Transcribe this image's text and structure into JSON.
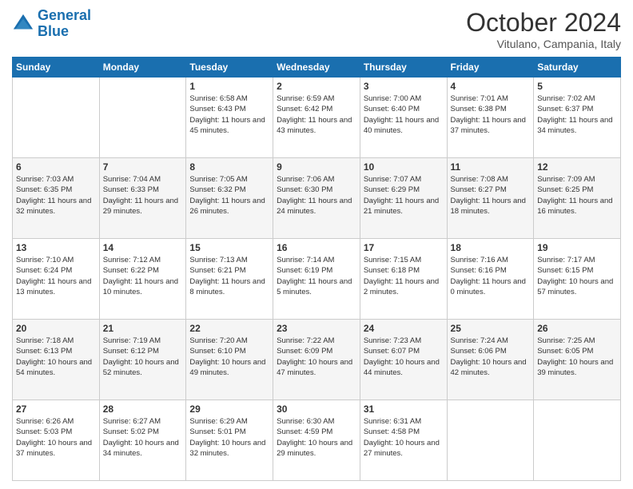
{
  "header": {
    "logo_line1": "General",
    "logo_line2": "Blue",
    "month": "October 2024",
    "location": "Vitulano, Campania, Italy"
  },
  "weekdays": [
    "Sunday",
    "Monday",
    "Tuesday",
    "Wednesday",
    "Thursday",
    "Friday",
    "Saturday"
  ],
  "weeks": [
    [
      {
        "day": null,
        "info": null
      },
      {
        "day": null,
        "info": null
      },
      {
        "day": "1",
        "info": "Sunrise: 6:58 AM\nSunset: 6:43 PM\nDaylight: 11 hours and 45 minutes."
      },
      {
        "day": "2",
        "info": "Sunrise: 6:59 AM\nSunset: 6:42 PM\nDaylight: 11 hours and 43 minutes."
      },
      {
        "day": "3",
        "info": "Sunrise: 7:00 AM\nSunset: 6:40 PM\nDaylight: 11 hours and 40 minutes."
      },
      {
        "day": "4",
        "info": "Sunrise: 7:01 AM\nSunset: 6:38 PM\nDaylight: 11 hours and 37 minutes."
      },
      {
        "day": "5",
        "info": "Sunrise: 7:02 AM\nSunset: 6:37 PM\nDaylight: 11 hours and 34 minutes."
      }
    ],
    [
      {
        "day": "6",
        "info": "Sunrise: 7:03 AM\nSunset: 6:35 PM\nDaylight: 11 hours and 32 minutes."
      },
      {
        "day": "7",
        "info": "Sunrise: 7:04 AM\nSunset: 6:33 PM\nDaylight: 11 hours and 29 minutes."
      },
      {
        "day": "8",
        "info": "Sunrise: 7:05 AM\nSunset: 6:32 PM\nDaylight: 11 hours and 26 minutes."
      },
      {
        "day": "9",
        "info": "Sunrise: 7:06 AM\nSunset: 6:30 PM\nDaylight: 11 hours and 24 minutes."
      },
      {
        "day": "10",
        "info": "Sunrise: 7:07 AM\nSunset: 6:29 PM\nDaylight: 11 hours and 21 minutes."
      },
      {
        "day": "11",
        "info": "Sunrise: 7:08 AM\nSunset: 6:27 PM\nDaylight: 11 hours and 18 minutes."
      },
      {
        "day": "12",
        "info": "Sunrise: 7:09 AM\nSunset: 6:25 PM\nDaylight: 11 hours and 16 minutes."
      }
    ],
    [
      {
        "day": "13",
        "info": "Sunrise: 7:10 AM\nSunset: 6:24 PM\nDaylight: 11 hours and 13 minutes."
      },
      {
        "day": "14",
        "info": "Sunrise: 7:12 AM\nSunset: 6:22 PM\nDaylight: 11 hours and 10 minutes."
      },
      {
        "day": "15",
        "info": "Sunrise: 7:13 AM\nSunset: 6:21 PM\nDaylight: 11 hours and 8 minutes."
      },
      {
        "day": "16",
        "info": "Sunrise: 7:14 AM\nSunset: 6:19 PM\nDaylight: 11 hours and 5 minutes."
      },
      {
        "day": "17",
        "info": "Sunrise: 7:15 AM\nSunset: 6:18 PM\nDaylight: 11 hours and 2 minutes."
      },
      {
        "day": "18",
        "info": "Sunrise: 7:16 AM\nSunset: 6:16 PM\nDaylight: 11 hours and 0 minutes."
      },
      {
        "day": "19",
        "info": "Sunrise: 7:17 AM\nSunset: 6:15 PM\nDaylight: 10 hours and 57 minutes."
      }
    ],
    [
      {
        "day": "20",
        "info": "Sunrise: 7:18 AM\nSunset: 6:13 PM\nDaylight: 10 hours and 54 minutes."
      },
      {
        "day": "21",
        "info": "Sunrise: 7:19 AM\nSunset: 6:12 PM\nDaylight: 10 hours and 52 minutes."
      },
      {
        "day": "22",
        "info": "Sunrise: 7:20 AM\nSunset: 6:10 PM\nDaylight: 10 hours and 49 minutes."
      },
      {
        "day": "23",
        "info": "Sunrise: 7:22 AM\nSunset: 6:09 PM\nDaylight: 10 hours and 47 minutes."
      },
      {
        "day": "24",
        "info": "Sunrise: 7:23 AM\nSunset: 6:07 PM\nDaylight: 10 hours and 44 minutes."
      },
      {
        "day": "25",
        "info": "Sunrise: 7:24 AM\nSunset: 6:06 PM\nDaylight: 10 hours and 42 minutes."
      },
      {
        "day": "26",
        "info": "Sunrise: 7:25 AM\nSunset: 6:05 PM\nDaylight: 10 hours and 39 minutes."
      }
    ],
    [
      {
        "day": "27",
        "info": "Sunrise: 6:26 AM\nSunset: 5:03 PM\nDaylight: 10 hours and 37 minutes."
      },
      {
        "day": "28",
        "info": "Sunrise: 6:27 AM\nSunset: 5:02 PM\nDaylight: 10 hours and 34 minutes."
      },
      {
        "day": "29",
        "info": "Sunrise: 6:29 AM\nSunset: 5:01 PM\nDaylight: 10 hours and 32 minutes."
      },
      {
        "day": "30",
        "info": "Sunrise: 6:30 AM\nSunset: 4:59 PM\nDaylight: 10 hours and 29 minutes."
      },
      {
        "day": "31",
        "info": "Sunrise: 6:31 AM\nSunset: 4:58 PM\nDaylight: 10 hours and 27 minutes."
      },
      {
        "day": null,
        "info": null
      },
      {
        "day": null,
        "info": null
      }
    ]
  ]
}
